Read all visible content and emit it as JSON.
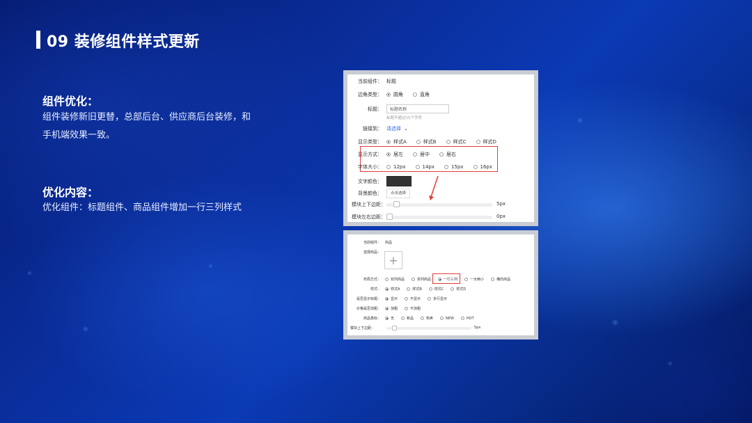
{
  "title": "09 装修组件样式更新",
  "section1": {
    "heading": "组件优化：",
    "text": "组件装修新旧更替，总部后台、供应商后台装修，和手机端效果一致。"
  },
  "section2": {
    "heading": "优化内容：",
    "text": "优化组件：标题组件、商品组件增加一行三列样式"
  },
  "panel1": {
    "current_label": "当前组件：",
    "current_value": "标题",
    "corner_label": "边角类型：",
    "corner_opts": [
      "圆角",
      "直角"
    ],
    "title_label": "标题：",
    "title_value": "标题名称",
    "title_hint": "标题不超过15个字符",
    "link_label": "链接到：",
    "link_value": "请选择",
    "display_type_label": "显示类型：",
    "display_type_opts": [
      "样式A",
      "样式B",
      "样式C",
      "样式D"
    ],
    "display_mode_label": "显示方式：",
    "display_mode_opts": [
      "居左",
      "居中",
      "居右"
    ],
    "font_size_label": "字体大小：",
    "font_size_opts": [
      "12px",
      "14px",
      "15px",
      "16px"
    ],
    "text_color_label": "文字颜色：",
    "bg_color_label": "背景颜色：",
    "bg_color_btn": "点击选择",
    "margin_v_label": "模块上下边距：",
    "margin_v_value": "5px",
    "margin_h_label": "模块左右边距：",
    "margin_h_value": "0px"
  },
  "panel2": {
    "current_label": "当前组件：",
    "current_value": "商品",
    "select_label": "选择商品：",
    "layout_label": "布局方式：",
    "layout_opts": [
      "双列商品",
      "单列商品",
      "一行三列",
      "一大两小",
      "横向商品"
    ],
    "style_label": "样式：",
    "style_opts": [
      "样式A",
      "样式B",
      "样式C",
      "样式D"
    ],
    "show_title_label": "是否显示标题：",
    "show_title_opts": [
      "显示",
      "不显示",
      "多行显示"
    ],
    "price_bold_label": "价格是否加粗：",
    "price_bold_opts": [
      "加粗",
      "不加粗"
    ],
    "badge_label": "商品角标：",
    "badge_opts": [
      "无",
      "新品",
      "热卖",
      "NEW",
      "HOT"
    ],
    "margin_v_label": "模块上下边距：",
    "margin_v_value": "5px"
  },
  "colors": {
    "accent_red": "#e53935",
    "link": "#3a6fd8",
    "bg": "#0b3ab5"
  }
}
